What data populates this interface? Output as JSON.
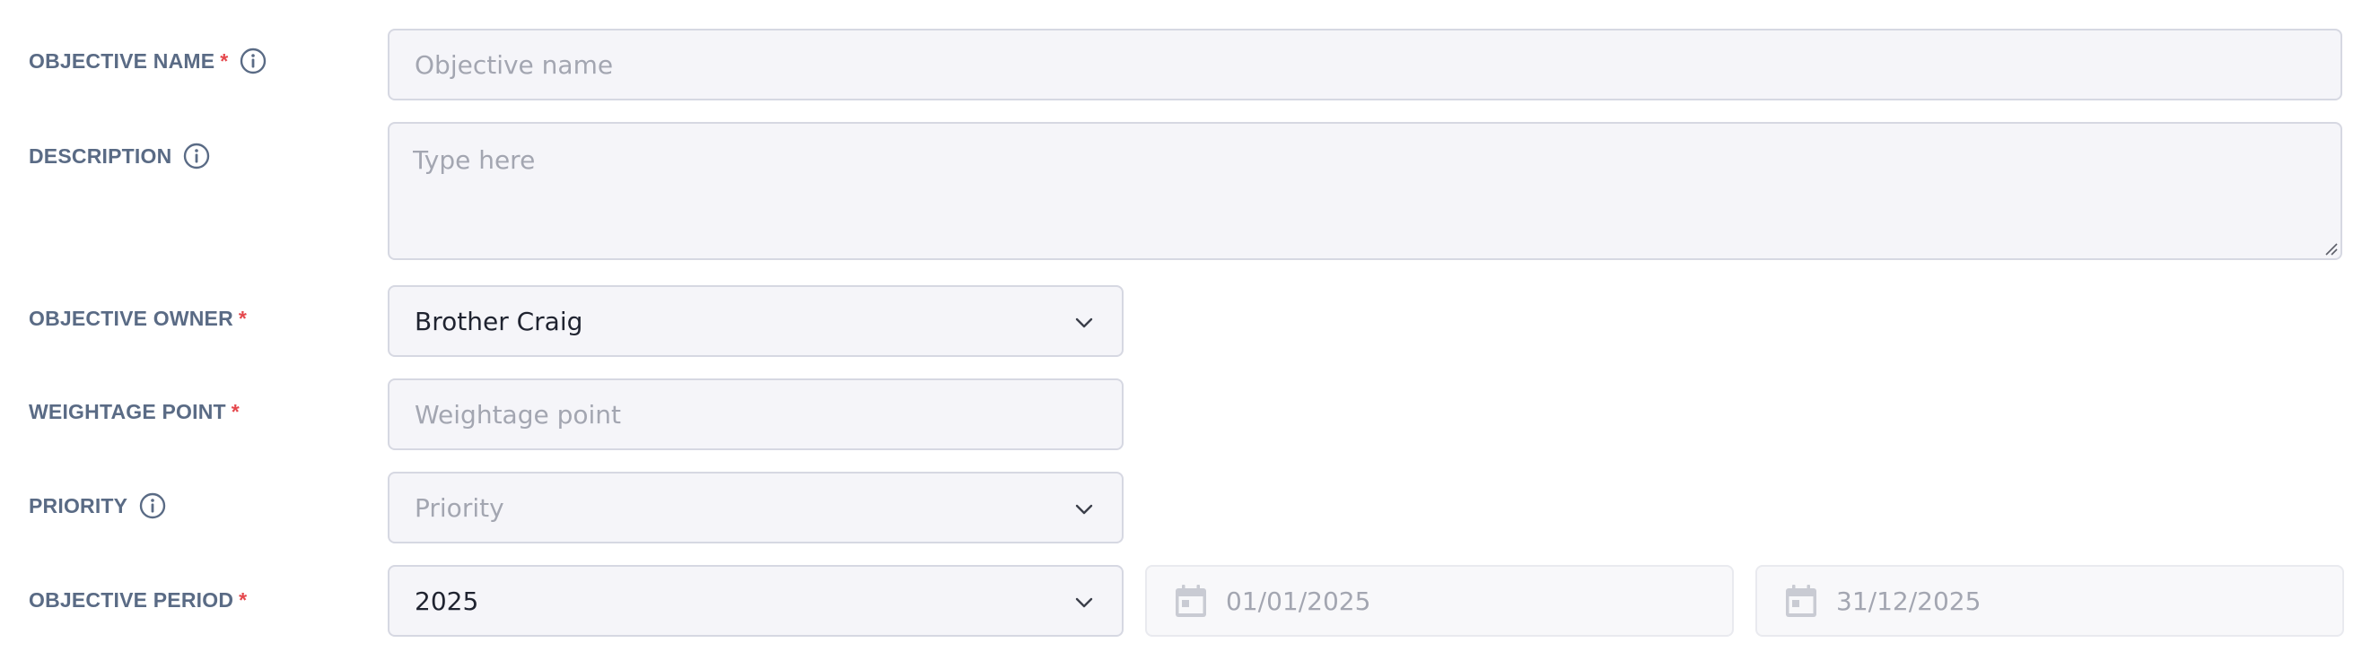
{
  "fields": {
    "objective_name": {
      "label": "OBJECTIVE NAME",
      "required": "*",
      "placeholder": "Objective name"
    },
    "description": {
      "label": "DESCRIPTION",
      "placeholder": "Type here"
    },
    "objective_owner": {
      "label": "OBJECTIVE OWNER",
      "required": "*",
      "value": "Brother Craig"
    },
    "weightage_point": {
      "label": "WEIGHTAGE POINT",
      "required": "*",
      "placeholder": "Weightage point"
    },
    "priority": {
      "label": "PRIORITY",
      "placeholder": "Priority"
    },
    "objective_period": {
      "label": "OBJECTIVE PERIOD",
      "required": "*",
      "year": "2025",
      "start_date": "01/01/2025",
      "end_date": "31/12/2025"
    }
  },
  "icons": {
    "info": "info-circle-icon",
    "chevron": "chevron-down-icon",
    "calendar": "calendar-icon"
  },
  "colors": {
    "label": "#5a6b85",
    "required": "#e5484d",
    "field_bg": "#f5f5f9",
    "field_border": "#d6d8e2",
    "placeholder": "#a3a6b1"
  }
}
